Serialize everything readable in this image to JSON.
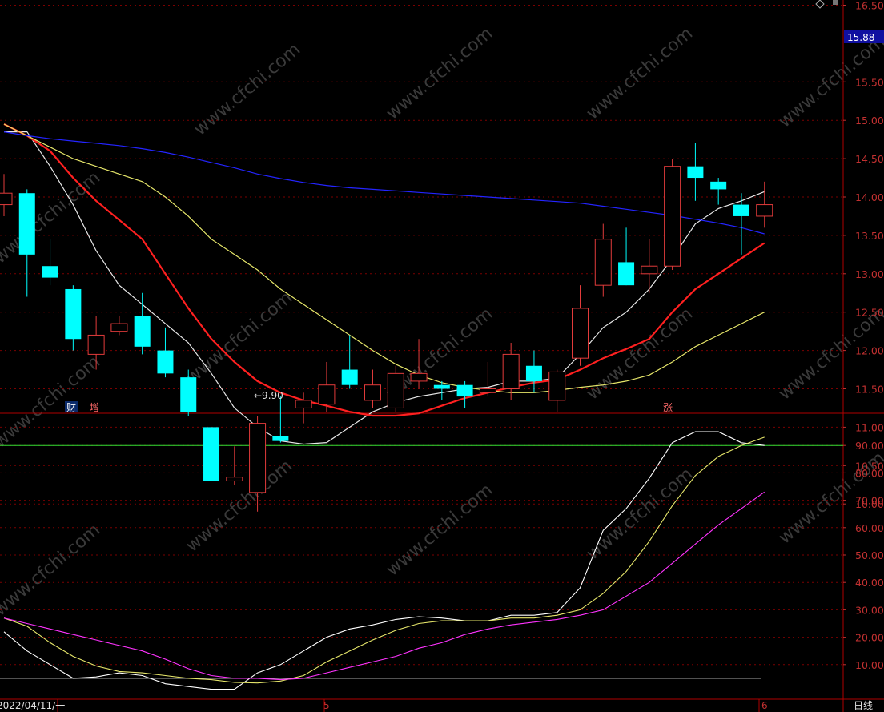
{
  "colors": {
    "background": "#000000",
    "up": "#e23b3b",
    "down": "#00ffff",
    "grid": "#7a0000",
    "axis_text": "#c03030",
    "ma_white": "#e8e8e8",
    "ma_red": "#ff2020",
    "ma_yellow": "#e6e66a",
    "ma_blue": "#2424ff",
    "k_line": "#ffffff",
    "d_line": "#e6e66a",
    "j_line": "#ff33ff",
    "threshold": "#33dd33",
    "last_price_bg": "#1010a0"
  },
  "price_axis": {
    "ticks": [
      "16.50",
      "15.50",
      "15.00",
      "14.50",
      "14.00",
      "13.50",
      "13.00",
      "12.50",
      "12.00",
      "11.50",
      "11.00",
      "10.50",
      "10.00"
    ],
    "last_price": "15.88"
  },
  "indicator_axis": {
    "ticks": [
      "90.00",
      "80.00",
      "70.00",
      "60.00",
      "50.00",
      "40.00",
      "30.00",
      "20.00",
      "10.00"
    ]
  },
  "time_axis": {
    "start_label": "2022/04/11/一",
    "mid_label": "5",
    "end_label": "6",
    "period_label": "日线"
  },
  "annotations": {
    "low_marker": "←9.90",
    "event_1": "财",
    "event_2": "增",
    "event_3": "涨"
  },
  "watermark": "www.cfchi.com",
  "chart_data": {
    "type": "candlestick",
    "ylim": [
      9.7,
      16.6
    ],
    "candles": [
      {
        "o": 13.9,
        "h": 14.3,
        "l": 13.75,
        "c": 14.05
      },
      {
        "o": 14.05,
        "h": 14.1,
        "l": 12.7,
        "c": 13.25
      },
      {
        "o": 13.1,
        "h": 13.45,
        "l": 12.85,
        "c": 12.95
      },
      {
        "o": 12.8,
        "h": 12.85,
        "l": 12.0,
        "c": 12.15
      },
      {
        "o": 11.95,
        "h": 12.45,
        "l": 11.75,
        "c": 12.2
      },
      {
        "o": 12.25,
        "h": 12.45,
        "l": 12.2,
        "c": 12.35
      },
      {
        "o": 12.45,
        "h": 12.75,
        "l": 11.95,
        "c": 12.05
      },
      {
        "o": 12.0,
        "h": 12.3,
        "l": 11.65,
        "c": 11.7
      },
      {
        "o": 11.65,
        "h": 11.75,
        "l": 11.15,
        "c": 11.2
      },
      {
        "o": 11.0,
        "h": 11.0,
        "l": 10.3,
        "c": 10.3
      },
      {
        "o": 10.3,
        "h": 10.75,
        "l": 10.25,
        "c": 10.35
      },
      {
        "o": 10.15,
        "h": 11.15,
        "l": 9.9,
        "c": 11.05
      },
      {
        "o": 10.88,
        "h": 11.4,
        "l": 10.8,
        "c": 10.82
      },
      {
        "o": 11.25,
        "h": 11.45,
        "l": 11.05,
        "c": 11.35
      },
      {
        "o": 11.3,
        "h": 11.85,
        "l": 11.2,
        "c": 11.55
      },
      {
        "o": 11.75,
        "h": 12.2,
        "l": 11.5,
        "c": 11.55
      },
      {
        "o": 11.35,
        "h": 11.75,
        "l": 11.25,
        "c": 11.55
      },
      {
        "o": 11.25,
        "h": 11.8,
        "l": 11.2,
        "c": 11.7
      },
      {
        "o": 11.6,
        "h": 12.15,
        "l": 11.5,
        "c": 11.7
      },
      {
        "o": 11.55,
        "h": 11.6,
        "l": 11.35,
        "c": 11.5
      },
      {
        "o": 11.55,
        "h": 11.6,
        "l": 11.25,
        "c": 11.4
      },
      {
        "o": 11.45,
        "h": 11.85,
        "l": 11.4,
        "c": 11.5
      },
      {
        "o": 11.5,
        "h": 12.1,
        "l": 11.35,
        "c": 11.95
      },
      {
        "o": 11.8,
        "h": 12.0,
        "l": 11.45,
        "c": 11.6
      },
      {
        "o": 11.35,
        "h": 11.75,
        "l": 11.2,
        "c": 11.72
      },
      {
        "o": 11.9,
        "h": 12.85,
        "l": 11.8,
        "c": 12.55
      },
      {
        "o": 12.85,
        "h": 13.65,
        "l": 12.7,
        "c": 13.45
      },
      {
        "o": 13.15,
        "h": 13.6,
        "l": 12.85,
        "c": 12.85
      },
      {
        "o": 13.0,
        "h": 13.45,
        "l": 12.75,
        "c": 13.1
      },
      {
        "o": 13.1,
        "h": 14.5,
        "l": 13.05,
        "c": 14.4
      },
      {
        "o": 14.4,
        "h": 14.7,
        "l": 13.95,
        "c": 14.25
      },
      {
        "o": 14.2,
        "h": 14.25,
        "l": 13.9,
        "c": 14.1
      },
      {
        "o": 13.9,
        "h": 14.05,
        "l": 13.25,
        "c": 13.75
      },
      {
        "o": 13.75,
        "h": 14.2,
        "l": 13.6,
        "c": 13.9
      }
    ],
    "ma": [
      {
        "color": "#e8e8e8",
        "values": [
          14.85,
          14.85,
          14.4,
          13.9,
          13.3,
          12.85,
          12.6,
          12.35,
          12.1,
          11.7,
          11.25,
          11.0,
          10.82,
          10.78,
          10.8,
          11.0,
          11.2,
          11.32,
          11.4,
          11.45,
          11.5,
          11.52,
          11.6,
          11.6,
          11.64,
          11.95,
          12.3,
          12.5,
          12.8,
          13.2,
          13.65,
          13.85,
          13.95,
          14.07
        ]
      },
      {
        "color": "#ff2020",
        "values": [
          14.95,
          14.8,
          14.6,
          14.25,
          13.95,
          13.7,
          13.45,
          13.0,
          12.55,
          12.15,
          11.85,
          11.6,
          11.45,
          11.35,
          11.28,
          11.2,
          11.15,
          11.15,
          11.18,
          11.28,
          11.38,
          11.45,
          11.52,
          11.58,
          11.62,
          11.75,
          11.9,
          12.02,
          12.15,
          12.5,
          12.8,
          13.0,
          13.2,
          13.4
        ]
      },
      {
        "color": "#e6e66a",
        "values": [
          14.95,
          14.8,
          14.65,
          14.5,
          14.4,
          14.3,
          14.2,
          14.0,
          13.75,
          13.45,
          13.25,
          13.05,
          12.8,
          12.6,
          12.4,
          12.2,
          12.0,
          11.82,
          11.68,
          11.58,
          11.52,
          11.48,
          11.45,
          11.45,
          11.48,
          11.52,
          11.55,
          11.6,
          11.68,
          11.85,
          12.05,
          12.2,
          12.35,
          12.5
        ]
      },
      {
        "color": "#2424ff",
        "values": [
          14.85,
          14.8,
          14.76,
          14.73,
          14.7,
          14.67,
          14.63,
          14.58,
          14.52,
          14.45,
          14.38,
          14.3,
          14.24,
          14.19,
          14.15,
          14.12,
          14.1,
          14.08,
          14.06,
          14.04,
          14.02,
          14.0,
          13.98,
          13.96,
          13.94,
          13.92,
          13.88,
          13.84,
          13.8,
          13.76,
          13.71,
          13.66,
          13.6,
          13.52
        ]
      }
    ],
    "kdj": [
      {
        "name": "K",
        "color": "#ffffff",
        "values": [
          22,
          15,
          10,
          5,
          5.5,
          7,
          6,
          3,
          2,
          1,
          1,
          7,
          10,
          15,
          20,
          23,
          24.5,
          26.5,
          27.5,
          27,
          26,
          26,
          28,
          28,
          29,
          38,
          59,
          67,
          78,
          91,
          95,
          95,
          91,
          90
        ]
      },
      {
        "name": "D",
        "color": "#e6e66a",
        "values": [
          27,
          24,
          18,
          13,
          9.5,
          7.5,
          7,
          6,
          5,
          4.5,
          3.5,
          3.3,
          4,
          6,
          11,
          15,
          19,
          22.5,
          25,
          26,
          26,
          26,
          27,
          27,
          28,
          30,
          36,
          44,
          55,
          68,
          79,
          86,
          90,
          93
        ]
      },
      {
        "name": "J",
        "color": "#ff33ff",
        "values": [
          27,
          25,
          23,
          21,
          19,
          17,
          15,
          12,
          8.5,
          6,
          5,
          5,
          4.5,
          5,
          7,
          9,
          11,
          13,
          16,
          18,
          21,
          23,
          24.5,
          25.5,
          26.5,
          28,
          30,
          35,
          40,
          47,
          54,
          61,
          67,
          73
        ]
      }
    ],
    "kdj_ylim": [
      0,
      100
    ],
    "threshold": 90,
    "baseline": 5
  }
}
